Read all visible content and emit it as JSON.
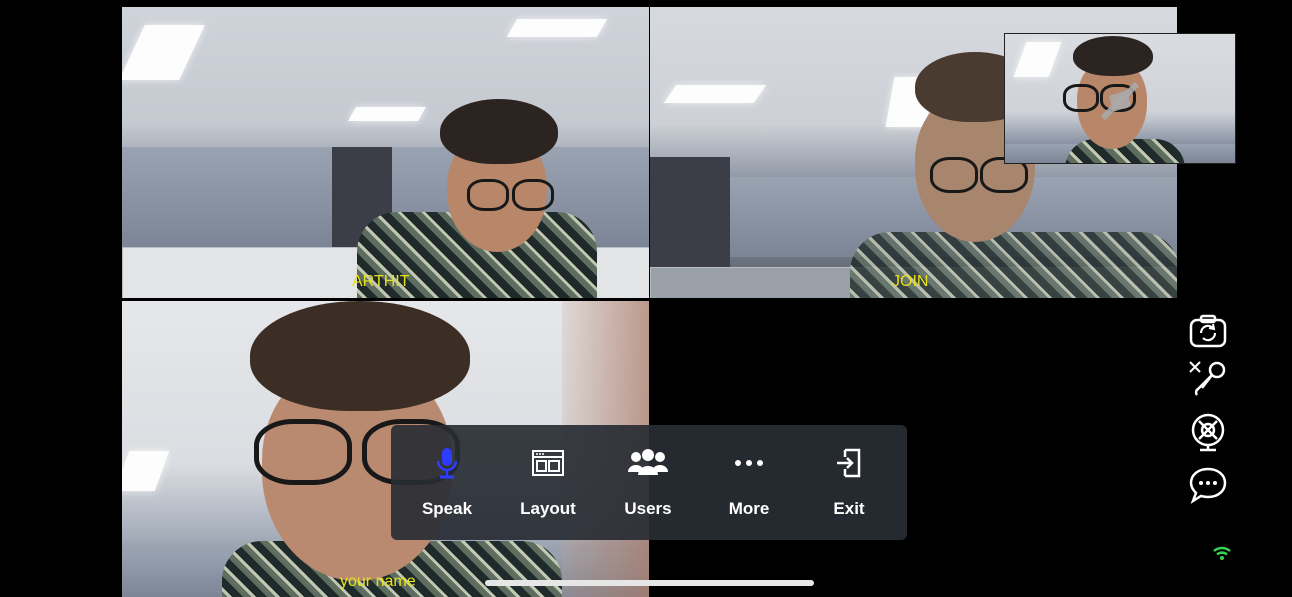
{
  "participants": [
    {
      "name": "ARTHIT"
    },
    {
      "name": "JOIN"
    },
    {
      "name": "your name"
    }
  ],
  "toolbar": {
    "items": [
      {
        "label": "Speak",
        "icon": "microphone-icon"
      },
      {
        "label": "Layout",
        "icon": "layout-icon"
      },
      {
        "label": "Users",
        "icon": "users-icon"
      },
      {
        "label": "More",
        "icon": "more-dots-icon"
      },
      {
        "label": "Exit",
        "icon": "exit-icon"
      }
    ]
  },
  "side_controls": [
    {
      "icon": "switch-camera-icon"
    },
    {
      "icon": "mic-muted-icon"
    },
    {
      "icon": "camera-off-icon"
    },
    {
      "icon": "chat-bubble-icon"
    }
  ],
  "colors": {
    "name_label": "#e8e21a",
    "speak_icon_active": "#2d3cff",
    "wifi": "#39d353",
    "toolbar_bg": "rgba(40,44,52,0.92)"
  },
  "status": {
    "wifi_icon": "wifi-icon",
    "pip_icon": "camera-off-icon"
  }
}
